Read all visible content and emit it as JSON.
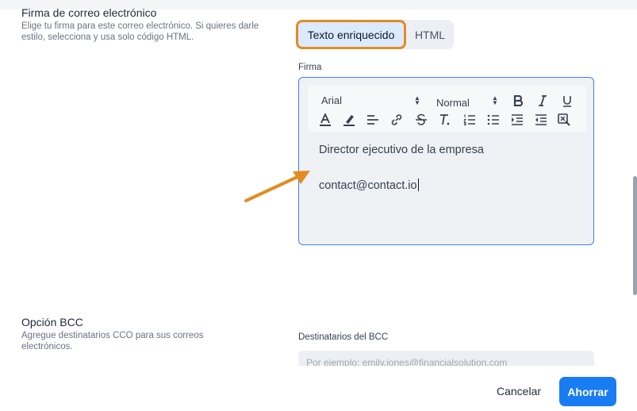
{
  "signature_section": {
    "title": "Firma de correo electrónico",
    "description": "Elige tu firma para este correo electrónico. Si quieres darle estilo, selecciona y usa solo código HTML."
  },
  "mode_toggle": {
    "rich_text": "Texto enriquecido",
    "html": "HTML",
    "selected": "Texto enriquecido"
  },
  "editor": {
    "label": "Firma",
    "font_family": "Arial",
    "font_size": "Normal",
    "toolbar_icons": [
      "bold-icon",
      "italic-icon",
      "underline-icon",
      "text-color-icon",
      "highlight-icon",
      "align-icon",
      "link-icon",
      "strikethrough-icon",
      "clear-format-icon",
      "ordered-list-icon",
      "bullet-list-icon",
      "indent-icon",
      "outdent-icon",
      "remove-format-icon"
    ],
    "lines": [
      "Director ejecutivo de la empresa",
      "contact@contact.io"
    ]
  },
  "bcc_section": {
    "title": "Opción BCC",
    "description": "Agregue destinatarios CCO para sus correos electrónicos.",
    "field_label": "Destinatarios del BCC",
    "placeholder": "Por ejemplo: emily.jones@financialsolution.com"
  },
  "footer": {
    "cancel_label": "Cancelar",
    "save_label": "Ahorrar"
  },
  "colors": {
    "accent": "#1a7cf2",
    "highlight_outline": "#e48b21",
    "editor_border": "#3b82f6"
  }
}
